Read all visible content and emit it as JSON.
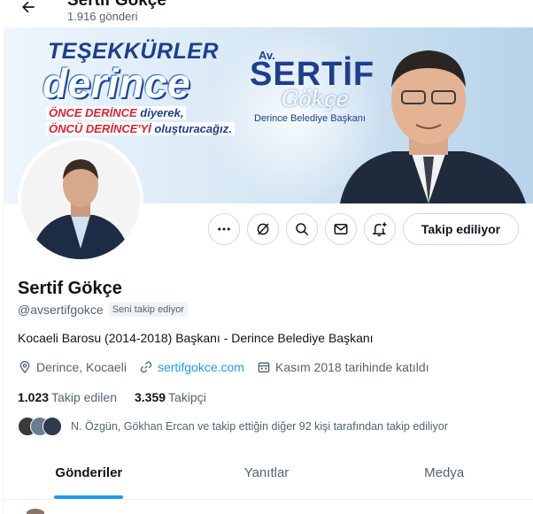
{
  "header": {
    "title": "Sertif Gökçe",
    "post_count": "1.916 gönderi"
  },
  "banner": {
    "thanks": "TEŞEKKÜRLER",
    "city": "derince",
    "line1_a": "ÖNCE DERİNCE",
    "line1_b": " diyerek,",
    "line2_a": "ÖNCÜ DERİNCE'Yİ",
    "line2_b": " oluşturacağız.",
    "av": "Av.",
    "first_name": "SERTİF",
    "last_name_script": "Gökçe",
    "title_line": "Derince Belediye Başkanı"
  },
  "actions": {
    "more_icon": "more-dots-icon",
    "grok_icon": "grok-icon",
    "search_icon": "search-icon",
    "message_icon": "envelope-icon",
    "notify_icon": "bell-plus-icon",
    "follow_label": "Takip ediliyor"
  },
  "profile": {
    "name": "Sertif Gökçe",
    "handle": "@avsertifgokce",
    "follows_you": "Seni takip ediyor",
    "bio": "Kocaeli Barosu (2014-2018) Başkanı - Derince Belediye Başkanı",
    "location": "Derince, Kocaeli",
    "website": "sertifgokce.com",
    "joined": "Kasım 2018 tarihinde katıldı",
    "following_count": "1.023",
    "following_label": "Takip edilen",
    "followers_count": "3.359",
    "followers_label": "Takipçi",
    "followed_by": "N. Özgün, Gökhan Ercan ve takip ettiğin diğer 92 kişi tarafından takip ediliyor"
  },
  "tabs": [
    {
      "label": "Gönderiler",
      "active": true
    },
    {
      "label": "Yanıtlar",
      "active": false
    },
    {
      "label": "Medya",
      "active": false
    }
  ],
  "colors": {
    "accent": "#1d9bf0",
    "banner_navy": "#1d3f8f",
    "banner_red": "#e0212f",
    "secondary_text": "#536471"
  }
}
